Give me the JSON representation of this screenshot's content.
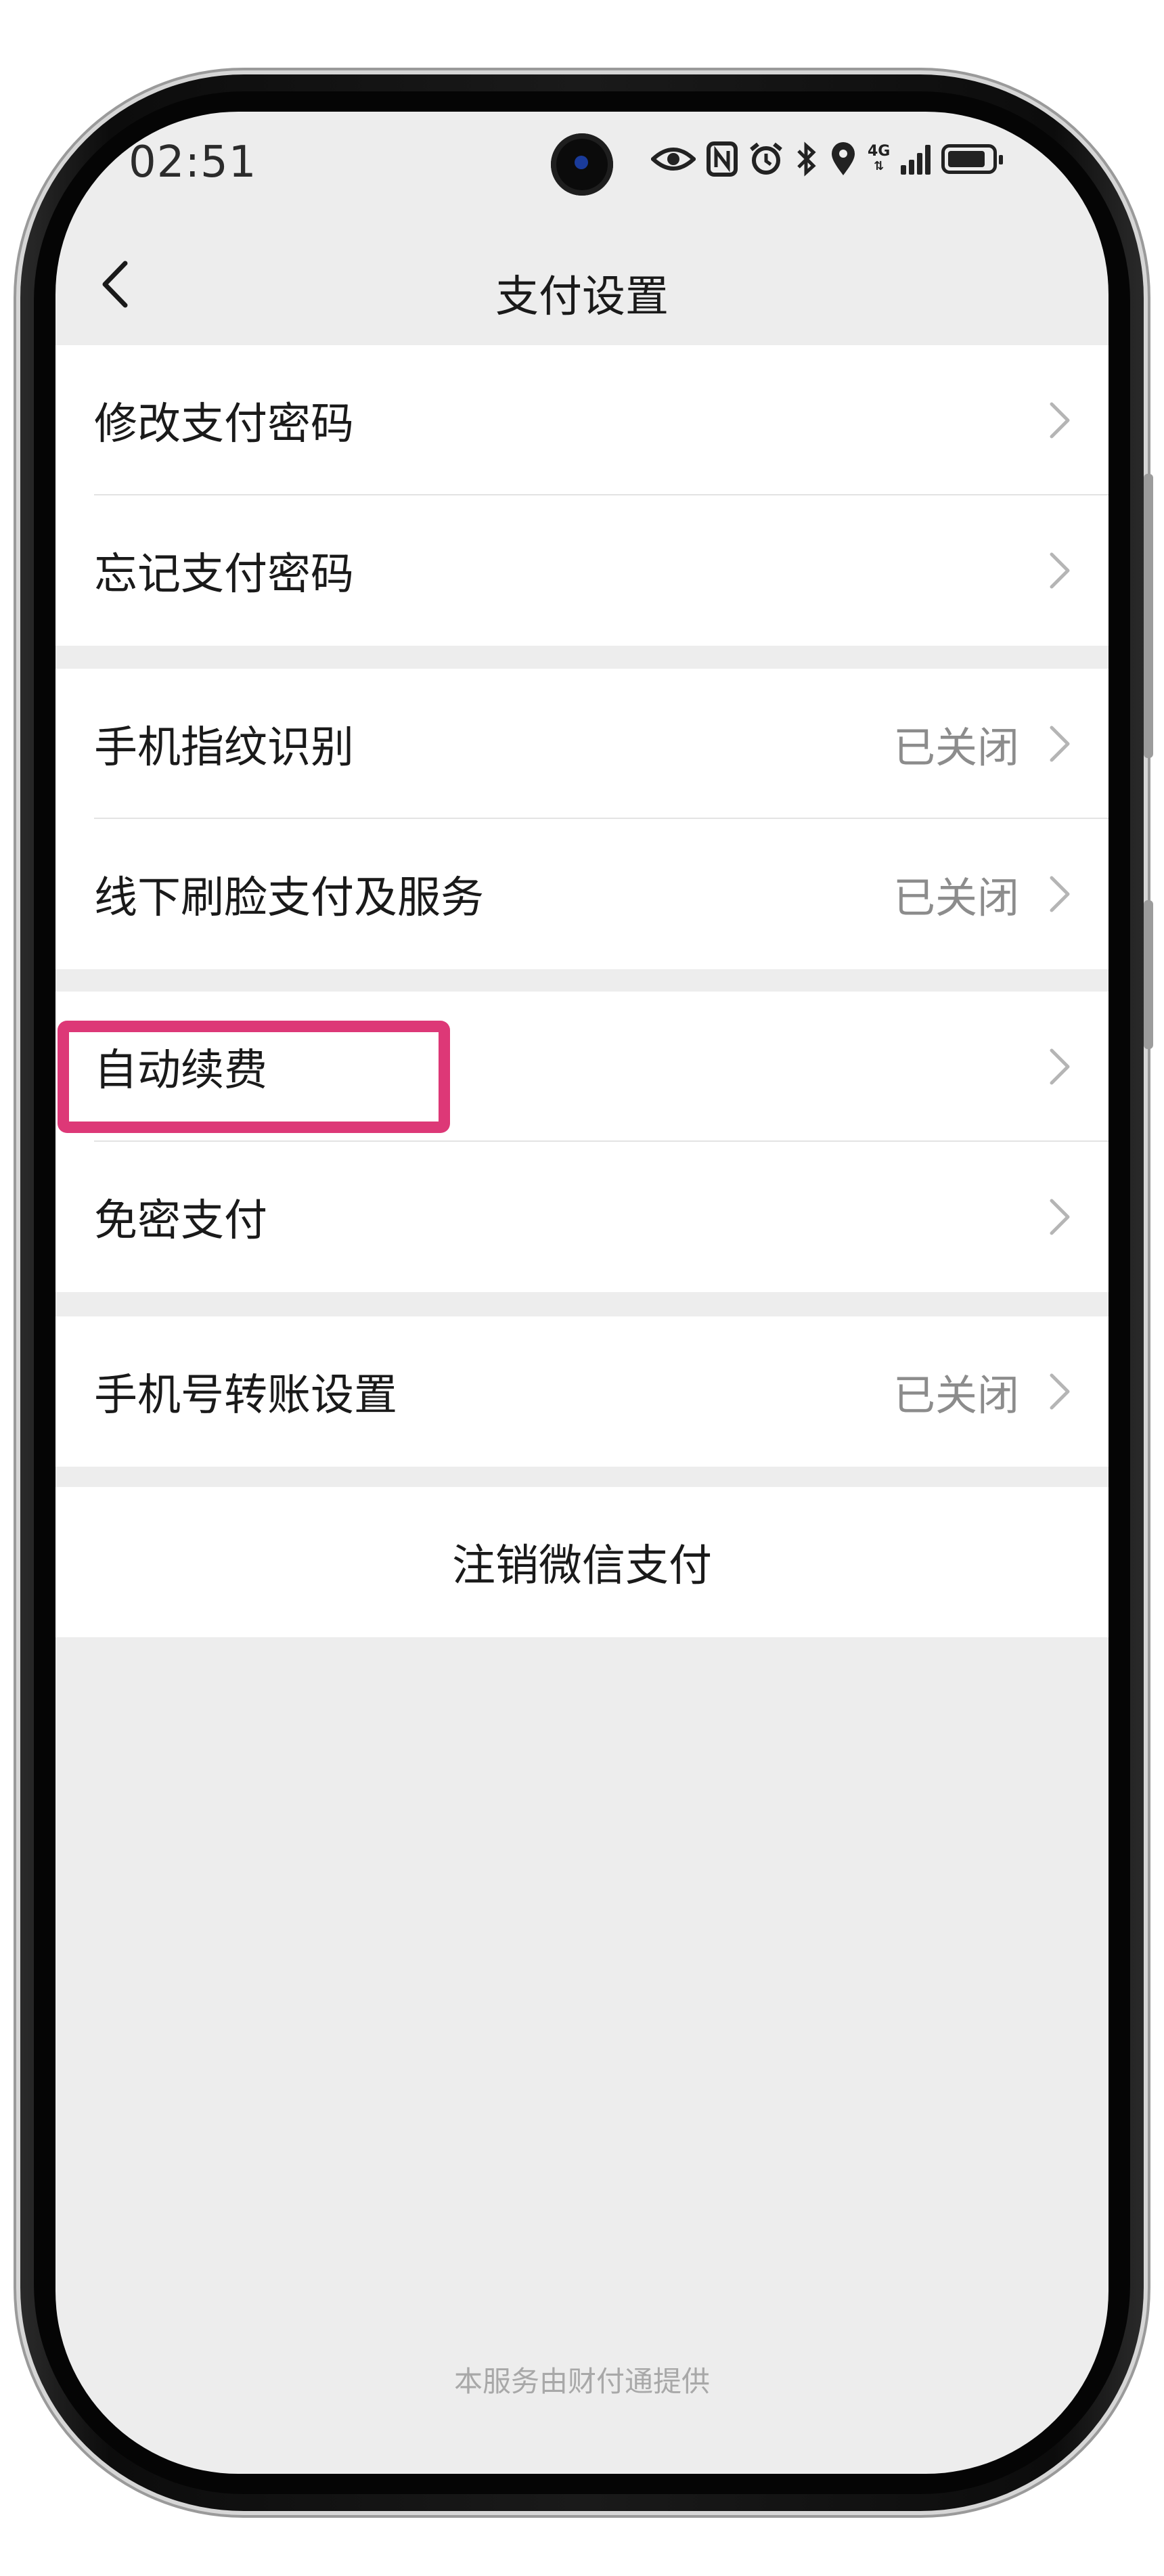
{
  "status_bar": {
    "time": "02:51",
    "network_type": "4G",
    "icons": [
      "eye-icon",
      "nfc-icon",
      "alarm-icon",
      "bluetooth-icon",
      "location-icon",
      "signal-icon",
      "battery-icon"
    ]
  },
  "nav": {
    "title": "支付设置",
    "back_icon": "chevron-left-icon"
  },
  "groups": [
    {
      "rows": [
        {
          "label": "修改支付密码",
          "value": ""
        },
        {
          "label": "忘记支付密码",
          "value": ""
        }
      ]
    },
    {
      "rows": [
        {
          "label": "手机指纹识别",
          "value": "已关闭"
        },
        {
          "label": "线下刷脸支付及服务",
          "value": "已关闭"
        }
      ]
    },
    {
      "rows": [
        {
          "label": "自动续费",
          "value": ""
        },
        {
          "label": "免密支付",
          "value": ""
        }
      ]
    },
    {
      "rows": [
        {
          "label": "手机号转账设置",
          "value": "已关闭"
        }
      ]
    }
  ],
  "deactivate_label": "注销微信支付",
  "footer_text": "本服务由财付通提供",
  "colors": {
    "highlight": "#dd3877",
    "background": "#ededed",
    "value_text": "#8c8c8c"
  }
}
